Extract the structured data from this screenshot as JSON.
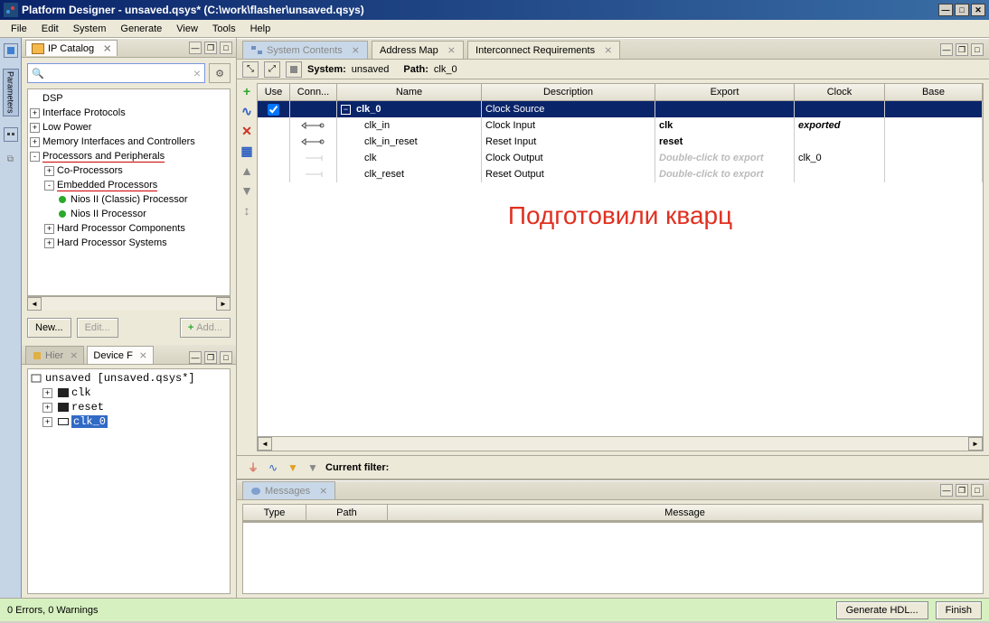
{
  "title": "Platform Designer - unsaved.qsys* (C:\\work\\flasher\\unsaved.qsys)",
  "menu": [
    "File",
    "Edit",
    "System",
    "Generate",
    "View",
    "Tools",
    "Help"
  ],
  "dock": {
    "tab": "Parameters"
  },
  "catalog": {
    "title": "IP Catalog",
    "search_placeholder": "",
    "nodes": [
      {
        "indent": 0,
        "toggle": "",
        "label": "DSP"
      },
      {
        "indent": 0,
        "toggle": "+",
        "label": "Interface Protocols"
      },
      {
        "indent": 0,
        "toggle": "+",
        "label": "Low Power"
      },
      {
        "indent": 0,
        "toggle": "+",
        "label": "Memory Interfaces and Controllers"
      },
      {
        "indent": 0,
        "toggle": "-",
        "label": "Processors and Peripherals",
        "red": true
      },
      {
        "indent": 1,
        "toggle": "+",
        "label": "Co-Processors"
      },
      {
        "indent": 1,
        "toggle": "-",
        "label": "Embedded Processors",
        "red": true
      },
      {
        "indent": 2,
        "bullet": true,
        "label": "Nios II (Classic) Processor"
      },
      {
        "indent": 2,
        "bullet": true,
        "label": "Nios II Processor"
      },
      {
        "indent": 1,
        "toggle": "+",
        "label": "Hard Processor Components"
      },
      {
        "indent": 1,
        "toggle": "+",
        "label": "Hard Processor Systems"
      }
    ],
    "buttons": {
      "new": "New...",
      "edit": "Edit...",
      "add": "Add..."
    }
  },
  "hier": {
    "tab1": "Hier",
    "tab2": "Device F",
    "root": "unsaved [unsaved.qsys*]",
    "items": [
      "clk",
      "reset",
      "clk_0"
    ]
  },
  "tabs": {
    "sys": "System Contents",
    "addr": "Address Map",
    "inter": "Interconnect Requirements"
  },
  "sysbar": {
    "system_label": "System:",
    "system_val": "unsaved",
    "path_label": "Path:",
    "path_val": "clk_0"
  },
  "grid": {
    "headers": {
      "use": "Use",
      "conn": "Conn...",
      "name": "Name",
      "desc": "Description",
      "export": "Export",
      "clock": "Clock",
      "base": "Base"
    },
    "rows": [
      {
        "selected": true,
        "checked": true,
        "expander": true,
        "name": "clk_0",
        "desc": "Clock Source",
        "export": "",
        "clock": ""
      },
      {
        "sub": true,
        "name": "clk_in",
        "desc": "Clock Input",
        "export": "clk",
        "clock": "exported",
        "export_bold": true
      },
      {
        "sub": true,
        "name": "clk_in_reset",
        "desc": "Reset Input",
        "export": "reset",
        "export_bold": true
      },
      {
        "sub": true,
        "dim": true,
        "name": "clk",
        "desc": "Clock Output",
        "export": "Double-click to export",
        "clock": "clk_0",
        "placeholder": true
      },
      {
        "sub": true,
        "dim": true,
        "name": "clk_reset",
        "desc": "Reset Output",
        "export": "Double-click to export",
        "placeholder": true
      }
    ]
  },
  "annotation": "Подготовили кварц",
  "filter": {
    "label": "Current filter:"
  },
  "messages": {
    "title": "Messages",
    "headers": {
      "type": "Type",
      "path": "Path",
      "msg": "Message"
    }
  },
  "status": {
    "left": "0 Errors, 0 Warnings",
    "gen": "Generate HDL...",
    "finish": "Finish"
  }
}
